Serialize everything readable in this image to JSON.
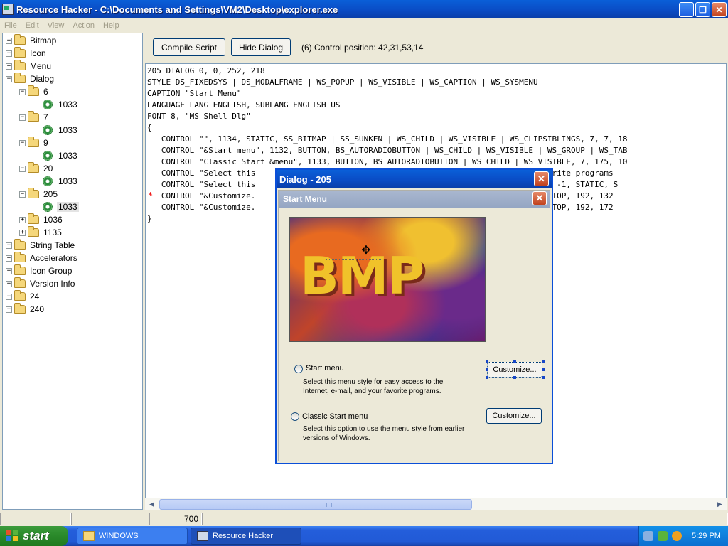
{
  "window": {
    "title": "Resource Hacker  -  C:\\Documents and Settings\\VM2\\Desktop\\explorer.exe",
    "buttons": {
      "minimize": "_",
      "maximize": "❐",
      "close": "✕"
    }
  },
  "menu": [
    "File",
    "Edit",
    "View",
    "Action",
    "Help"
  ],
  "tree": [
    {
      "label": "Bitmap",
      "level": 0,
      "type": "folder",
      "expander": "+"
    },
    {
      "label": "Icon",
      "level": 0,
      "type": "folder",
      "expander": "+"
    },
    {
      "label": "Menu",
      "level": 0,
      "type": "folder",
      "expander": "+"
    },
    {
      "label": "Dialog",
      "level": 0,
      "type": "folder",
      "expander": "−"
    },
    {
      "label": "6",
      "level": 1,
      "type": "folder",
      "expander": "−"
    },
    {
      "label": "1033",
      "level": 2,
      "type": "resource"
    },
    {
      "label": "7",
      "level": 1,
      "type": "folder",
      "expander": "−"
    },
    {
      "label": "1033",
      "level": 2,
      "type": "resource"
    },
    {
      "label": "9",
      "level": 1,
      "type": "folder",
      "expander": "−"
    },
    {
      "label": "1033",
      "level": 2,
      "type": "resource"
    },
    {
      "label": "20",
      "level": 1,
      "type": "folder",
      "expander": "−"
    },
    {
      "label": "1033",
      "level": 2,
      "type": "resource"
    },
    {
      "label": "205",
      "level": 1,
      "type": "folder",
      "expander": "−"
    },
    {
      "label": "1033",
      "level": 2,
      "type": "resource",
      "selected": true
    },
    {
      "label": "1036",
      "level": 1,
      "type": "folder",
      "expander": "+"
    },
    {
      "label": "1135",
      "level": 1,
      "type": "folder",
      "expander": "+"
    },
    {
      "label": "String Table",
      "level": 0,
      "type": "folder",
      "expander": "+"
    },
    {
      "label": "Accelerators",
      "level": 0,
      "type": "folder",
      "expander": "+"
    },
    {
      "label": "Icon Group",
      "level": 0,
      "type": "folder",
      "expander": "+"
    },
    {
      "label": "Version Info",
      "level": 0,
      "type": "folder",
      "expander": "+"
    },
    {
      "label": "24",
      "level": 0,
      "type": "folder",
      "expander": "+"
    },
    {
      "label": "240",
      "level": 0,
      "type": "folder",
      "expander": "+"
    }
  ],
  "toolbar": {
    "compile_label": "Compile Script",
    "hide_label": "Hide Dialog",
    "control_position": "(6)  Control position: 42,31,53,14"
  },
  "script_lines": [
    "205 DIALOG 0, 0, 252, 218",
    "STYLE DS_FIXEDSYS | DS_MODALFRAME | WS_POPUP | WS_VISIBLE | WS_CAPTION | WS_SYSMENU",
    "CAPTION \"Start Menu\"",
    "LANGUAGE LANG_ENGLISH, SUBLANG_ENGLISH_US",
    "FONT 8, \"MS Shell Dlg\"",
    "{",
    "   CONTROL \"\", 1134, STATIC, SS_BITMAP | SS_SUNKEN | WS_CHILD | WS_VISIBLE | WS_CLIPSIBLINGS, 7, 7, 18",
    "   CONTROL \"&Start menu\", 1132, BUTTON, BS_AUTORADIOBUTTON | WS_CHILD | WS_VISIBLE | WS_GROUP | WS_TAB",
    "   CONTROL \"Classic Start &menu\", 1133, BUTTON, BS_AUTORADIOBUTTON | WS_CHILD | WS_VISIBLE, 7, 175, 10",
    "   CONTROL \"Select this                                              il, and your favorite programs",
    "   CONTROL \"Select this                                              ons of Windows.\", -1, STATIC, S",
    "   CONTROL \"&Customize.                                              VISIBLE | WS_TABSTOP, 192, 132",
    "   CONTROL \"&Customize.                                              VISIBLE | WS_TABSTOP, 192, 172",
    "}"
  ],
  "modified_marker": "*",
  "statusbar": {
    "cell3": "700"
  },
  "dialog": {
    "outer_title": "Dialog -  205",
    "inner_title": "Start Menu",
    "close_glyph": "✕",
    "bitmap_text": "BMP",
    "move_glyph": "✥",
    "options": [
      {
        "label": "Start menu",
        "desc": "Select this menu style for easy access to the Internet, e-mail, and your favorite programs.",
        "button": "Customize..."
      },
      {
        "label": "Classic Start menu",
        "desc": "Select this option to use the menu style from earlier versions of Windows.",
        "button": "Customize..."
      }
    ]
  },
  "taskbar": {
    "start_label": "start",
    "tasks": [
      "WINDOWS",
      "Resource Hacker"
    ],
    "clock": "5:29 PM"
  },
  "colors": {
    "title_blue": "#0a4cc5",
    "taskbar_blue": "#245edb",
    "start_green": "#2c8c2c",
    "modified_marker": "#e00000"
  }
}
